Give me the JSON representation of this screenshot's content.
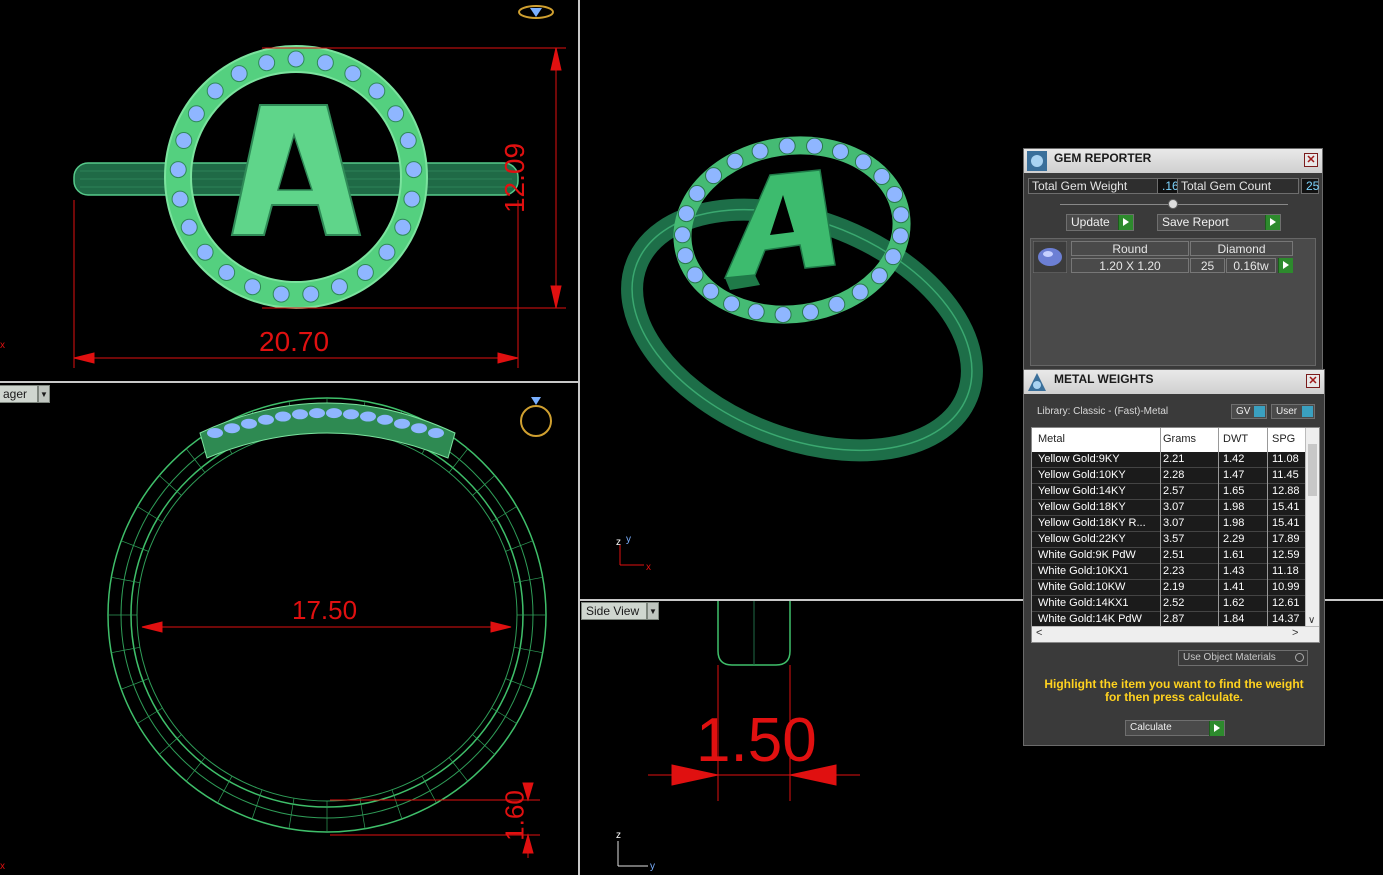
{
  "viewports": {
    "front": {
      "dim_width": "20.70",
      "dim_height": "12.09",
      "letter": "A"
    },
    "top": {
      "label": "ager",
      "dim_inner": "17.50",
      "dim_thick": "1.60"
    },
    "side": {
      "label": "Side View",
      "dim_width": "1.50"
    },
    "axis": {
      "x": "x",
      "y": "y",
      "z": "z"
    }
  },
  "gem_reporter": {
    "title": "GEM REPORTER",
    "close_glyph": "✕",
    "weight_label": "Total Gem Weight",
    "weight_value": ".16",
    "count_label": "Total Gem Count",
    "count_value": "25",
    "update_label": "Update",
    "save_label": "Save Report",
    "gem": {
      "shape": "Round",
      "type": "Diamond",
      "size": "1.20 X 1.20",
      "count": "25",
      "weight": "0.16tw"
    }
  },
  "metal_weights": {
    "title": "METAL WEIGHTS",
    "close_glyph": "✕",
    "library": "Library: Classic - (Fast)-Metal",
    "gv_label": "GV",
    "user_label": "User",
    "columns": [
      "Metal",
      "Grams",
      "DWT",
      "SPG"
    ],
    "rows": [
      [
        "Yellow Gold:9KY",
        "2.21",
        "1.42",
        "11.08"
      ],
      [
        "Yellow Gold:10KY",
        "2.28",
        "1.47",
        "11.45"
      ],
      [
        "Yellow Gold:14KY",
        "2.57",
        "1.65",
        "12.88"
      ],
      [
        "Yellow Gold:18KY",
        "3.07",
        "1.98",
        "15.41"
      ],
      [
        "Yellow Gold:18KY R...",
        "3.07",
        "1.98",
        "15.41"
      ],
      [
        "Yellow Gold:22KY",
        "3.57",
        "2.29",
        "17.89"
      ],
      [
        "White Gold:9K PdW",
        "2.51",
        "1.61",
        "12.59"
      ],
      [
        "White Gold:10KX1",
        "2.23",
        "1.43",
        "11.18"
      ],
      [
        "White Gold:10KW",
        "2.19",
        "1.41",
        "10.99"
      ],
      [
        "White Gold:14KX1",
        "2.52",
        "1.62",
        "12.61"
      ],
      [
        "White Gold:14K PdW",
        "2.87",
        "1.84",
        "14.37"
      ]
    ],
    "use_object_label": "Use Object Materials",
    "hint_line1": "Highlight the item you want to find the weight",
    "hint_line2": "for then press calculate.",
    "calculate_label": "Calculate",
    "scroll_left": "<",
    "scroll_right": ">",
    "scroll_down": "∨"
  },
  "colors": {
    "accent_green": "#3fbf6a",
    "dim_red": "#e01010",
    "gem_blue": "#8fb6ff",
    "hint_yellow": "#ffd21f"
  }
}
